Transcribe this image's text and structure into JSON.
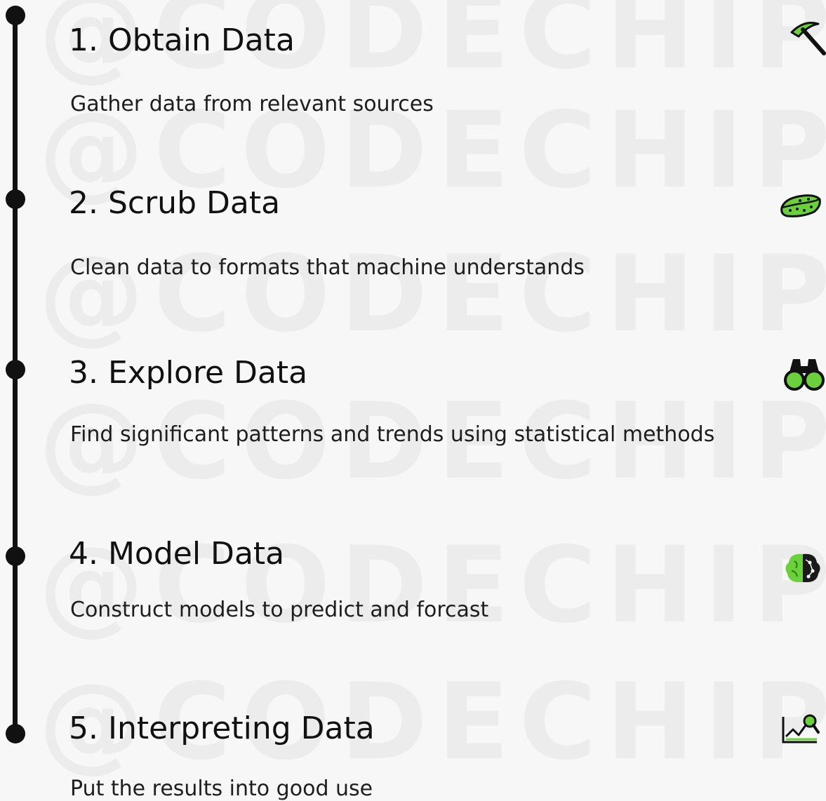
{
  "watermark": {
    "text": "@CODECHIPS"
  },
  "steps": [
    {
      "title": "1. Obtain Data",
      "description": "Gather data from relevant sources",
      "icon": "pickaxe-icon"
    },
    {
      "title": "2. Scrub Data",
      "description": "Clean data to formats that machine understands",
      "icon": "sponge-icon"
    },
    {
      "title": "3. Explore Data",
      "description": "Find significant patterns and trends using statistical methods",
      "icon": "binoculars-icon"
    },
    {
      "title": "4. Model Data",
      "description": "Construct models to predict and forcast",
      "icon": "brain-icon"
    },
    {
      "title": "5. Interpreting Data",
      "description": "Put the results into good use",
      "icon": "chart-magnifier-icon"
    }
  ],
  "colors": {
    "accent": "#6ad13a",
    "timeline": "#111111",
    "background": "#f7f7f7"
  }
}
